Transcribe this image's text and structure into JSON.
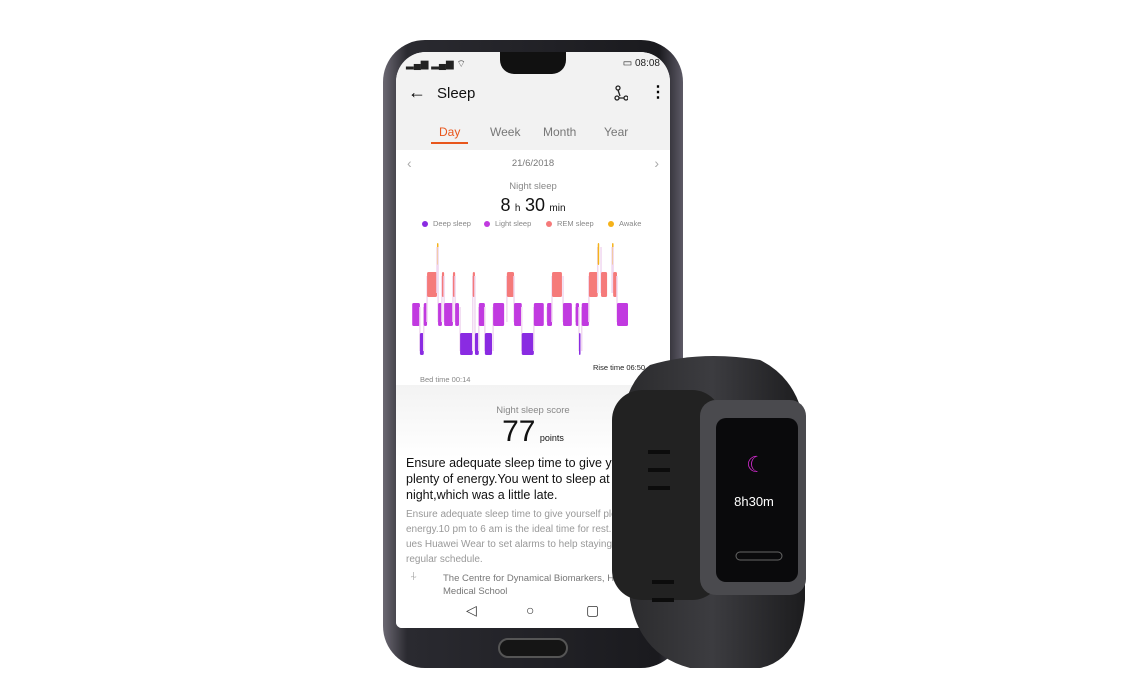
{
  "status": {
    "time": "08:08",
    "icons": [
      "signal-icon",
      "signal-icon",
      "wifi-icon",
      "battery-icon"
    ]
  },
  "header": {
    "title": "Sleep",
    "back_icon": "arrow-left-icon",
    "share_icon": "share-nodes-icon",
    "menu_icon": "more-vertical-icon"
  },
  "tabs": [
    {
      "label": "Day",
      "active": true
    },
    {
      "label": "Week"
    },
    {
      "label": "Month"
    },
    {
      "label": "Year"
    }
  ],
  "date": "21/6/2018",
  "summary": {
    "label": "Night sleep",
    "hours": "8",
    "h_unit": "h",
    "minutes": "30",
    "min_unit": "min"
  },
  "legend": [
    {
      "label": "Deep sleep",
      "color": "#8a2be2"
    },
    {
      "label": "Light sleep",
      "color": "#c13ae0"
    },
    {
      "label": "REM sleep",
      "color": "#f57a7a"
    },
    {
      "label": "Awake",
      "color": "#f5b21a"
    }
  ],
  "chart_data": {
    "type": "bar",
    "subtype": "sleep-stage-timeline",
    "stages": [
      "Awake",
      "REM sleep",
      "Light sleep",
      "Deep sleep"
    ],
    "start": "00:14",
    "end": "06:50",
    "start_label": "Bed time 00:14",
    "end_label": "Rise time 06:50",
    "segments": [
      [
        "Light sleep",
        "00:18",
        "00:32"
      ],
      [
        "Deep sleep",
        "00:32",
        "00:39"
      ],
      [
        "Light sleep",
        "00:39",
        "00:45"
      ],
      [
        "REM sleep",
        "00:45",
        "01:03"
      ],
      [
        "Awake",
        "01:03",
        "01:05"
      ],
      [
        "Light sleep",
        "01:05",
        "01:12"
      ],
      [
        "REM sleep",
        "01:12",
        "01:16"
      ],
      [
        "Light sleep",
        "01:16",
        "01:32"
      ],
      [
        "REM sleep",
        "01:32",
        "01:36"
      ],
      [
        "Light sleep",
        "01:36",
        "01:43"
      ],
      [
        "Deep sleep",
        "01:45",
        "02:08"
      ],
      [
        "REM sleep",
        "02:08",
        "02:12"
      ],
      [
        "Deep sleep",
        "02:12",
        "02:19"
      ],
      [
        "Light sleep",
        "02:19",
        "02:30"
      ],
      [
        "Deep sleep",
        "02:30",
        "02:43"
      ],
      [
        "Light sleep",
        "02:45",
        "03:05"
      ],
      [
        "REM sleep",
        "03:10",
        "03:23"
      ],
      [
        "Light sleep",
        "03:23",
        "03:37"
      ],
      [
        "Deep sleep",
        "03:37",
        "03:59"
      ],
      [
        "Light sleep",
        "03:59",
        "04:17"
      ],
      [
        "Light sleep",
        "04:23",
        "04:32"
      ],
      [
        "REM sleep",
        "04:32",
        "04:50"
      ],
      [
        "Light sleep",
        "04:52",
        "05:08"
      ],
      [
        "Light sleep",
        "05:15",
        "05:21"
      ],
      [
        "Deep sleep",
        "05:21",
        "05:23"
      ],
      [
        "Light sleep",
        "05:26",
        "05:39"
      ],
      [
        "REM sleep",
        "05:39",
        "05:55"
      ],
      [
        "Awake",
        "05:55",
        "05:57"
      ],
      [
        "REM sleep",
        "06:01",
        "06:12"
      ],
      [
        "Awake",
        "06:21",
        "06:23"
      ],
      [
        "REM sleep",
        "06:23",
        "06:30"
      ],
      [
        "Light sleep",
        "06:30",
        "06:50"
      ]
    ]
  },
  "score": {
    "label": "Night sleep score",
    "value": "77",
    "unit": "points"
  },
  "advice": {
    "lines": [
      "Ensure adequate sleep time to give yourse",
      "plenty of energy.You went to sleep at 00:1",
      "night,which was a little late."
    ],
    "detail": [
      "Ensure adequate sleep time to give yourself plen",
      "energy.10 pm to 6 am is the ideal time for rest. Y",
      "ues Huawei Wear to set alarms to help staying",
      "regular schedule."
    ],
    "source": [
      "The Centre for Dynamical Biomarkers, Har",
      "Medical School"
    ]
  },
  "band": {
    "time": "8h30m",
    "icon": "moon-sleep-icon"
  },
  "colors": {
    "accent": "#e8561c"
  }
}
